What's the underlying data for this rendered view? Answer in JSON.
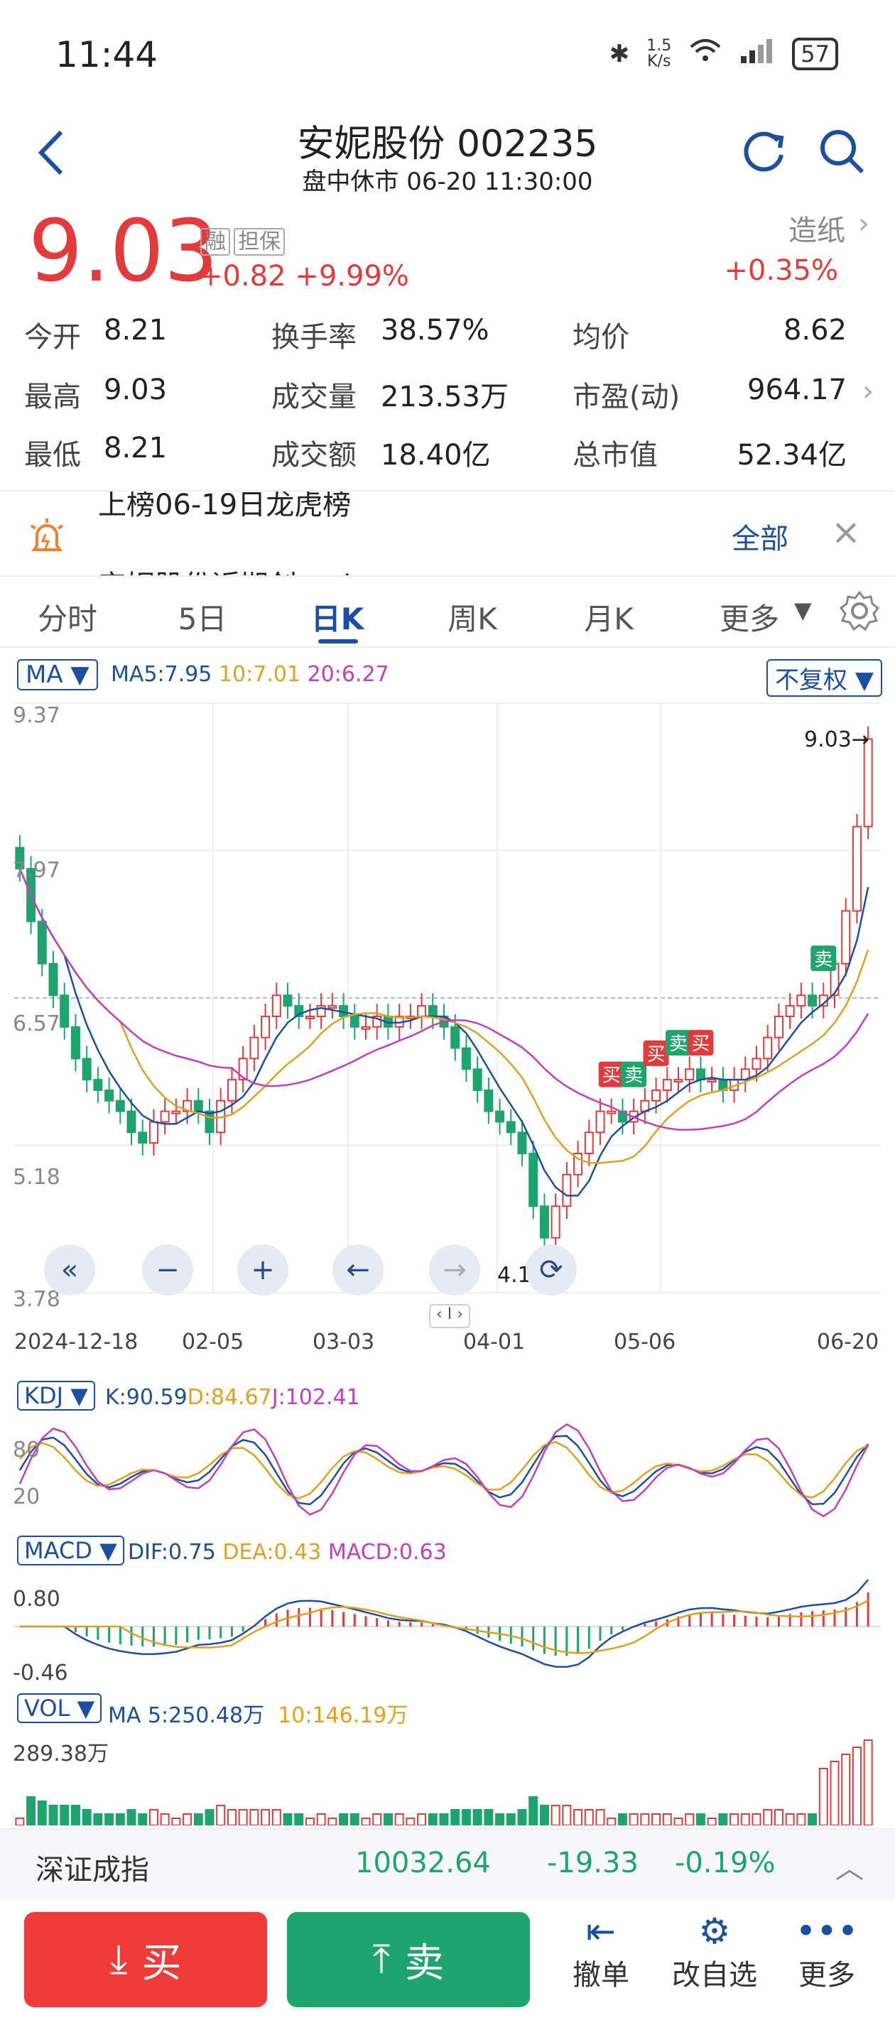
{
  "status_bar": {
    "time": "11:44",
    "net_speed_top": "1.5",
    "net_speed_unit": "K/s",
    "battery": "57"
  },
  "header": {
    "title": "安妮股份 002235",
    "subtitle": "盘中休市 06-20 11:30:00"
  },
  "quote": {
    "price": "9.03",
    "change": "+0.82",
    "change_pct": "+9.99%",
    "tag1": "融",
    "tag2": "担保",
    "sector": "造纸",
    "sector_change": "+0.35%"
  },
  "stats": [
    {
      "label": "今开",
      "value": "8.21"
    },
    {
      "label": "换手率",
      "value": "38.57%"
    },
    {
      "label": "均价",
      "value": "8.62"
    },
    {
      "label": "最高",
      "value": "9.03"
    },
    {
      "label": "成交量",
      "value": "213.53万"
    },
    {
      "label": "市盈(动)",
      "value": "964.17"
    },
    {
      "label": "最低",
      "value": "8.21"
    },
    {
      "label": "成交额",
      "value": "18.40亿"
    },
    {
      "label": "总市值",
      "value": "52.34亿"
    }
  ],
  "news": {
    "line1": "上榜06-19日龙虎榜",
    "line2": "安妮股份近期创under",
    "all_label": "全部"
  },
  "tabs": [
    "分时",
    "5日",
    "日K",
    "周K",
    "月K",
    "更多"
  ],
  "main_indicator": {
    "name": "MA",
    "ma5": "MA5:7.95",
    "ma10": "10:7.01",
    "ma20": "20:6.27",
    "adjust": "不复权"
  },
  "kdj": {
    "name": "KDJ",
    "k": "K:90.59",
    "d": "D:84.67",
    "j": "J:102.41",
    "tick_top": "80",
    "tick_bot": "20"
  },
  "macd": {
    "name": "MACD",
    "dif": "DIF:0.75",
    "dea": "DEA:0.43",
    "macd": "MACD:0.63",
    "tick_top": "0.80",
    "tick_bot": "-0.46"
  },
  "vol": {
    "name": "VOL",
    "ma5": "MA 5:250.48万",
    "ma10": "10:146.19万",
    "tick_top": "289.38万"
  },
  "index_bar": {
    "name": "深证成指",
    "value": "10032.64",
    "change": "-19.33",
    "change_pct": "-0.19%"
  },
  "bottom": {
    "buy": "买",
    "sell": "卖",
    "cancel": "撤单",
    "watchlist": "改自选",
    "more": "更多"
  },
  "chart_data": {
    "type": "candlestick",
    "y_ticks": [
      "9.37",
      "7.97",
      "6.57",
      "5.18",
      "3.78"
    ],
    "x_ticks": [
      "2024-12-18",
      "02-05",
      "03-03",
      "04-01",
      "05-06",
      "06-20"
    ],
    "high_label": "9.03→",
    "low_label": "4.12→",
    "ylim": [
      3.78,
      9.37
    ],
    "closes": [
      7.8,
      7.3,
      6.9,
      6.6,
      6.3,
      6.0,
      5.8,
      5.7,
      5.6,
      5.5,
      5.3,
      5.2,
      5.4,
      5.5,
      5.5,
      5.6,
      5.5,
      5.3,
      5.6,
      5.8,
      6.0,
      6.2,
      6.4,
      6.6,
      6.5,
      6.4,
      6.4,
      6.5,
      6.5,
      6.4,
      6.3,
      6.3,
      6.4,
      6.3,
      6.4,
      6.4,
      6.5,
      6.4,
      6.3,
      6.1,
      5.9,
      5.7,
      5.5,
      5.4,
      5.3,
      5.1,
      4.6,
      4.3,
      4.6,
      4.9,
      5.1,
      5.3,
      5.5,
      5.5,
      5.4,
      5.5,
      5.6,
      5.7,
      5.8,
      5.8,
      5.9,
      5.8,
      5.8,
      5.7,
      5.8,
      5.9,
      6.0,
      6.2,
      6.4,
      6.5,
      6.6,
      6.5,
      6.6,
      6.9,
      7.4,
      8.2,
      9.03
    ],
    "signals": [
      {
        "idx": 53,
        "label": "买"
      },
      {
        "idx": 55,
        "label": "卖"
      },
      {
        "idx": 57,
        "label": "买"
      },
      {
        "idx": 59,
        "label": "卖"
      },
      {
        "idx": 61,
        "label": "买"
      },
      {
        "idx": 72,
        "label": "卖"
      }
    ]
  },
  "colors": {
    "up": "#e33b3b",
    "down": "#1ea56f",
    "accent": "#1c4fa0"
  }
}
